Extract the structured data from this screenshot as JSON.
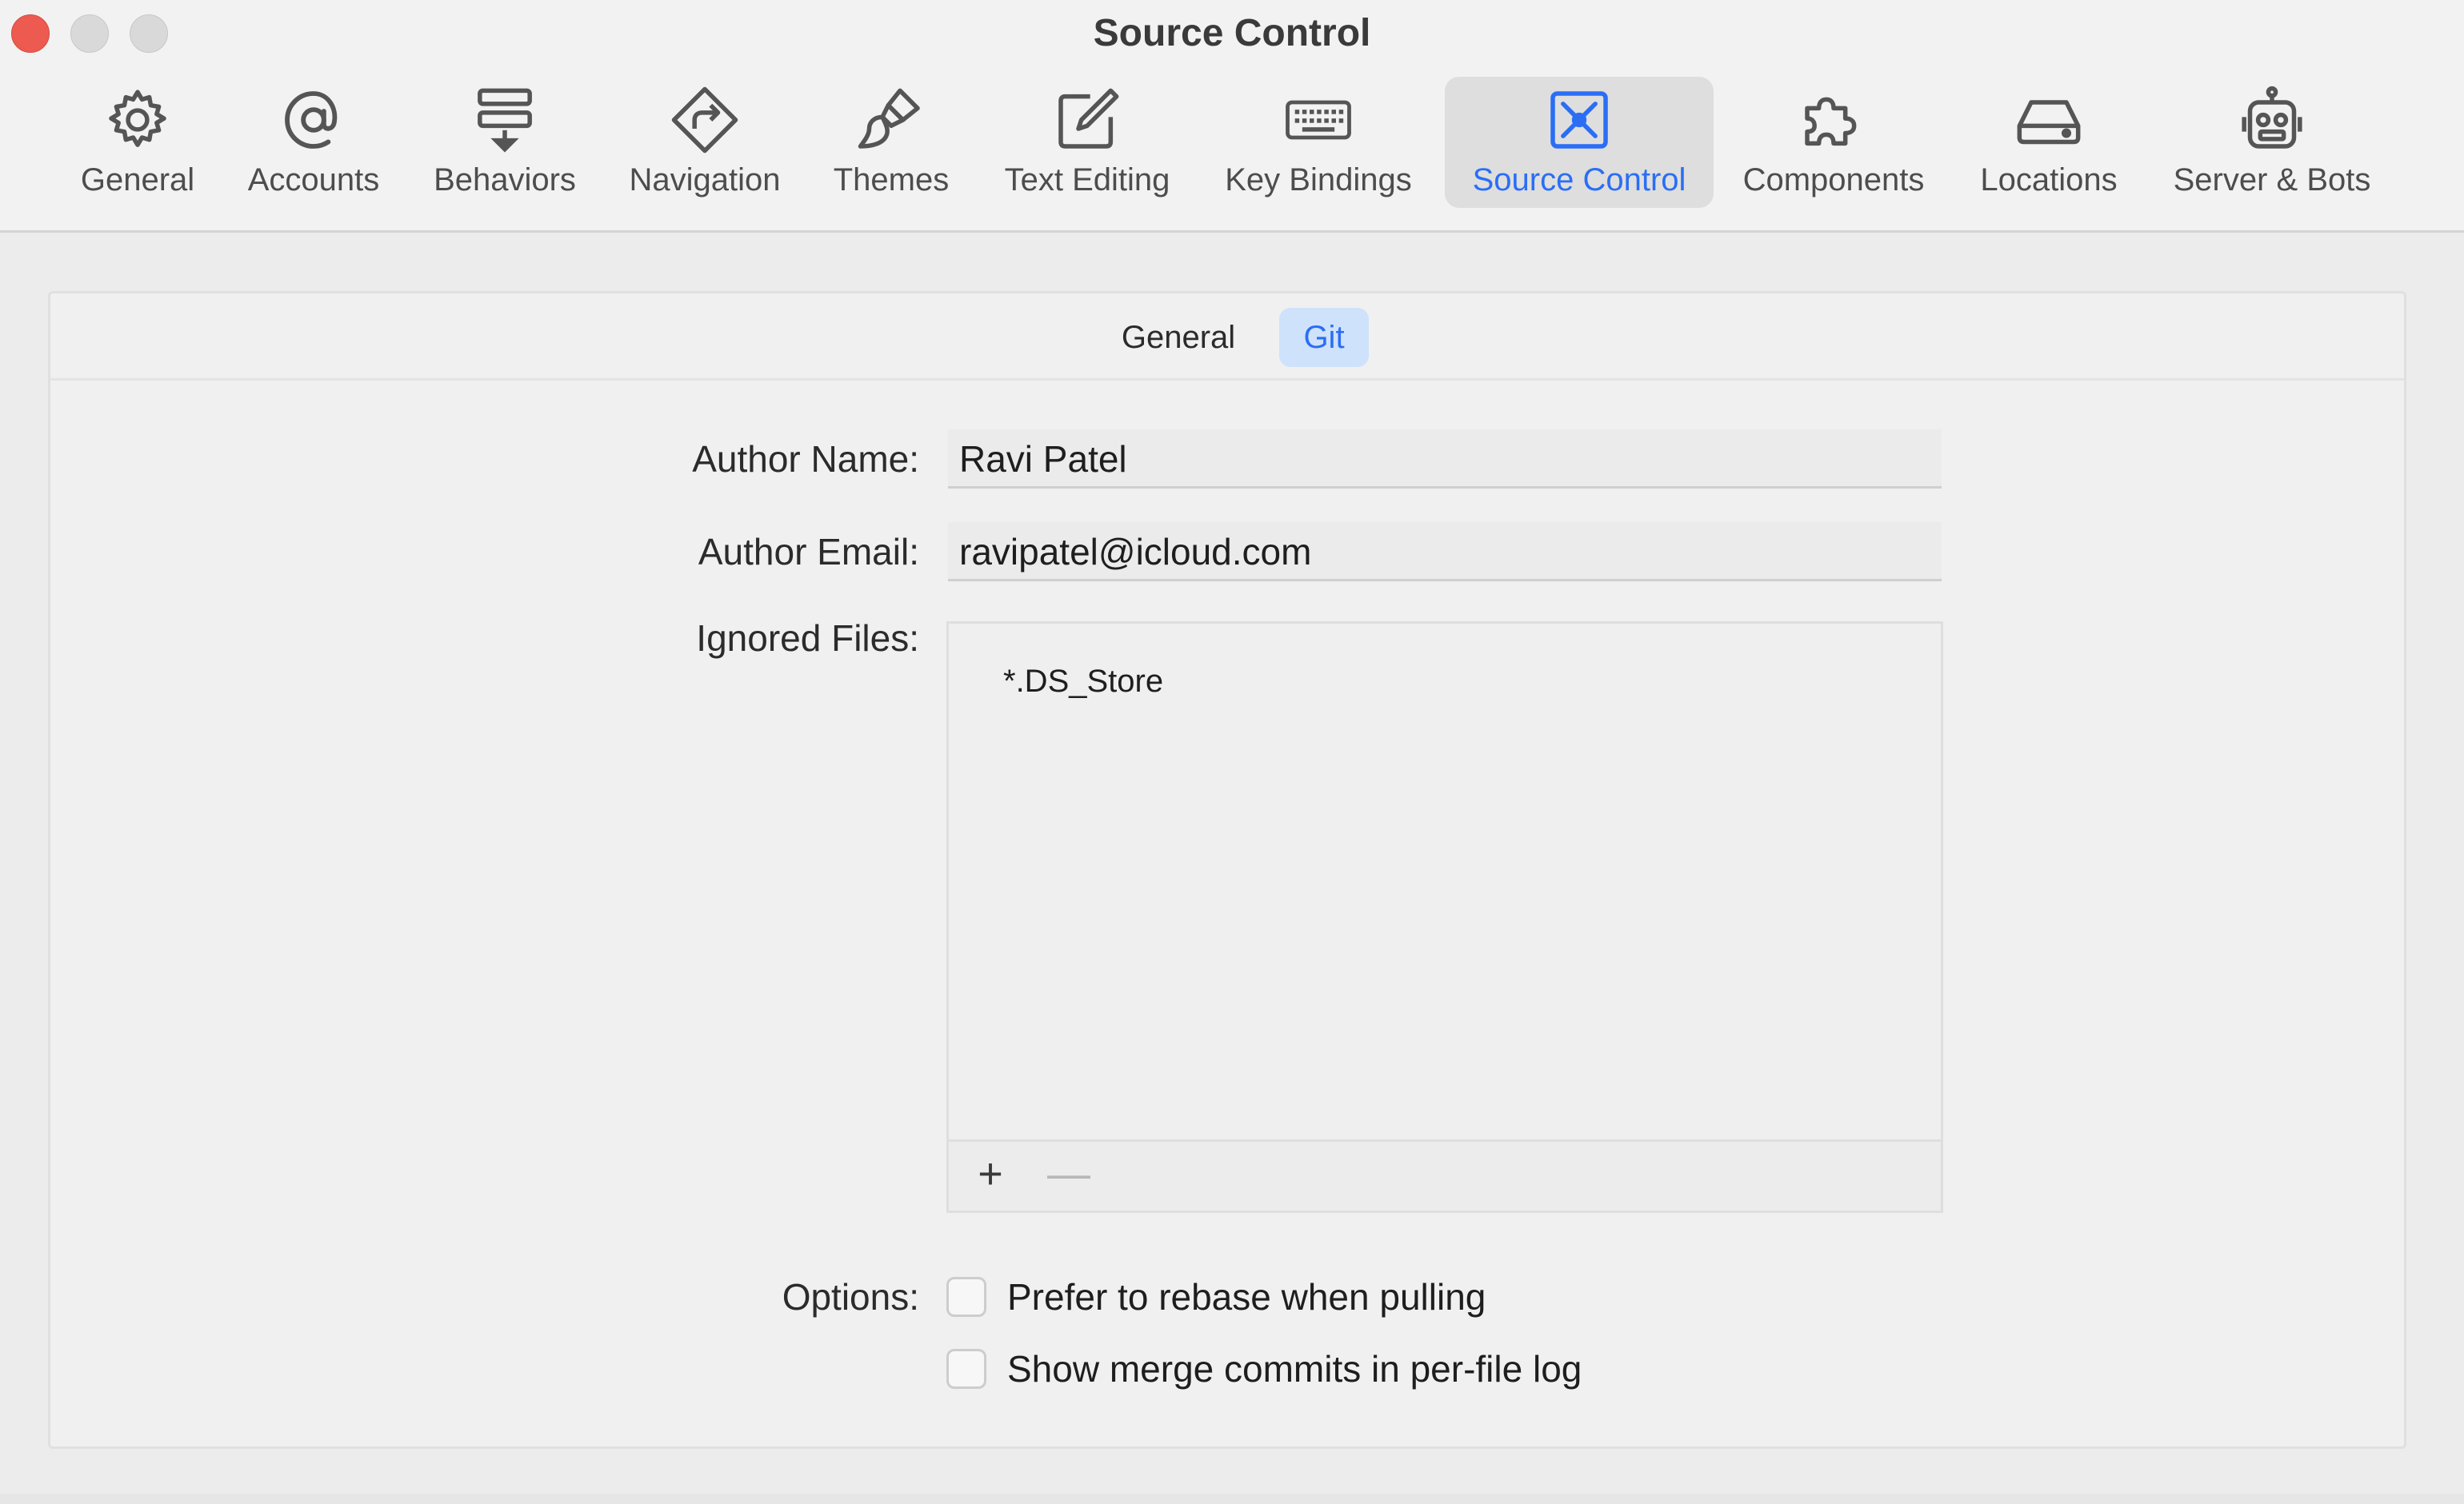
{
  "window": {
    "title": "Source Control"
  },
  "toolbar": {
    "items": [
      {
        "label": "General",
        "icon": "gear-icon"
      },
      {
        "label": "Accounts",
        "icon": "at-icon"
      },
      {
        "label": "Behaviors",
        "icon": "behaviors-icon"
      },
      {
        "label": "Navigation",
        "icon": "navigation-icon"
      },
      {
        "label": "Themes",
        "icon": "paintbrush-icon"
      },
      {
        "label": "Text Editing",
        "icon": "pencil-square-icon"
      },
      {
        "label": "Key Bindings",
        "icon": "keyboard-icon"
      },
      {
        "label": "Source Control",
        "icon": "source-control-icon"
      },
      {
        "label": "Components",
        "icon": "puzzle-icon"
      },
      {
        "label": "Locations",
        "icon": "drive-icon"
      },
      {
        "label": "Server & Bots",
        "icon": "robot-icon"
      }
    ],
    "selected": "Source Control"
  },
  "tabs": {
    "general": "General",
    "git": "Git",
    "selected": "Git"
  },
  "form": {
    "author_name_label": "Author Name:",
    "author_name_value": "Ravi Patel",
    "author_email_label": "Author Email:",
    "author_email_value": "ravipatel@icloud.com",
    "ignored_files_label": "Ignored Files:",
    "ignored_files": [
      "*.DS_Store"
    ],
    "add_symbol": "+",
    "remove_symbol": "—",
    "options_label": "Options:",
    "options": [
      {
        "label": "Prefer to rebase when pulling",
        "checked": false
      },
      {
        "label": "Show merge commits in per-file log",
        "checked": false
      }
    ]
  },
  "colors": {
    "accent": "#2a6ef5",
    "close_button": "#ed5a50",
    "selected_tab_bg": "#cfe2fb"
  }
}
